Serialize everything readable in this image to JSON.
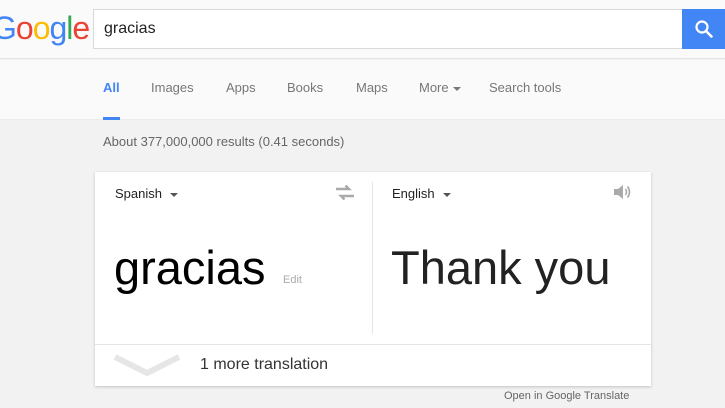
{
  "logo": {
    "letters": [
      "G",
      "o",
      "o",
      "g",
      "l",
      "e"
    ]
  },
  "search": {
    "query": "gracias"
  },
  "tabs": [
    {
      "label": "All"
    },
    {
      "label": "Images"
    },
    {
      "label": "Apps"
    },
    {
      "label": "Books"
    },
    {
      "label": "Maps"
    },
    {
      "label": "More"
    },
    {
      "label": "Search tools"
    }
  ],
  "stats": "About 377,000,000 results (0.41 seconds)",
  "translate": {
    "source_lang": "Spanish",
    "target_lang": "English",
    "source_text": "gracias",
    "edit_label": "Edit",
    "target_text": "Thank you",
    "more_translations": "1 more translation",
    "open_link": "Open in Google Translate"
  },
  "colors": {
    "blue": "#4285f4",
    "red": "#ea4335",
    "yellow": "#fbbc05",
    "green": "#34a853"
  }
}
